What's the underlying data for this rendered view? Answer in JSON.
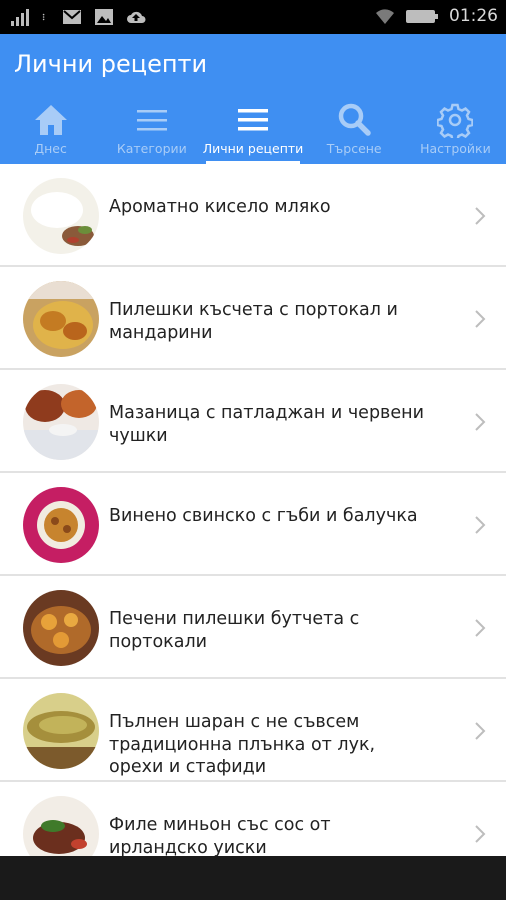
{
  "status_bar": {
    "time": "01:26",
    "icons": [
      "signal-icon",
      "more-vert-icon",
      "gmail-icon",
      "image-icon",
      "cloud-upload-icon",
      "wifi-icon",
      "battery-icon"
    ]
  },
  "app": {
    "title": "Лични рецепти",
    "accent_color": "#3f8ff2"
  },
  "tabs": [
    {
      "label": "Днес",
      "icon": "home-icon",
      "active": false
    },
    {
      "label": "Категории",
      "icon": "list-icon",
      "active": false
    },
    {
      "label": "Лични рецепти",
      "icon": "menu-icon",
      "active": true
    },
    {
      "label": "Търсене",
      "icon": "search-icon",
      "active": false
    },
    {
      "label": "Настройки",
      "icon": "gear-icon",
      "active": false
    }
  ],
  "recipes": [
    {
      "title": "Ароматно кисело мляко",
      "thumb": "yogurt-thumbnail"
    },
    {
      "title": "Пилешки късчета с портокал и мандарини",
      "thumb": "chicken-orange-thumbnail"
    },
    {
      "title": "Мазаница с патладжан и червени чушки",
      "thumb": "eggplant-pepper-thumbnail"
    },
    {
      "title": "Винено свинско с гъби и балучка",
      "thumb": "pork-mushroom-thumbnail"
    },
    {
      "title": "Печени пилешки бутчета с портокали",
      "thumb": "roast-chicken-thumbnail"
    },
    {
      "title": "Пълнен шаран с не съвсем традиционна плънка от лук, орехи и стафиди",
      "thumb": "stuffed-carp-thumbnail"
    },
    {
      "title": "Филе миньон със сос от ирландско уиски",
      "thumb": "filet-mignon-thumbnail"
    }
  ]
}
